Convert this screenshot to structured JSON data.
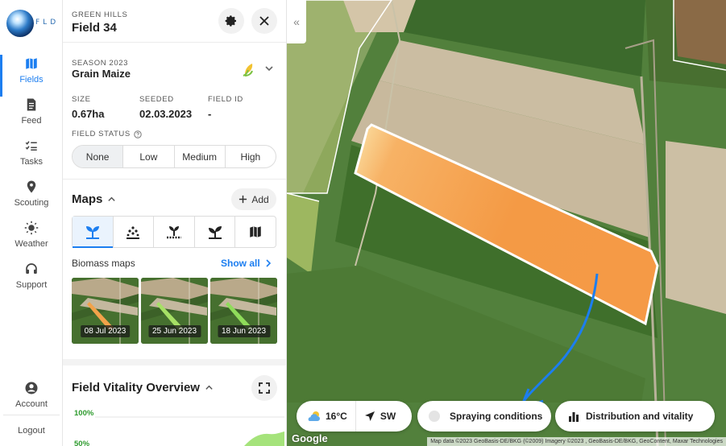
{
  "brand": {
    "wordmark": "FLD"
  },
  "nav": {
    "items": [
      {
        "label": "Fields",
        "icon": "map-icon",
        "active": true
      },
      {
        "label": "Feed",
        "icon": "document-icon"
      },
      {
        "label": "Tasks",
        "icon": "checklist-icon"
      },
      {
        "label": "Scouting",
        "icon": "pin-icon"
      },
      {
        "label": "Weather",
        "icon": "sun-icon"
      },
      {
        "label": "Support",
        "icon": "headset-icon"
      }
    ],
    "account_label": "Account",
    "logout_label": "Logout"
  },
  "field": {
    "farm": "GREEN HILLS",
    "name": "Field 34",
    "season_label": "SEASON 2023",
    "crop": "Grain Maize",
    "stats": [
      {
        "key": "SIZE",
        "value": "0.67ha"
      },
      {
        "key": "SEEDED",
        "value": "02.03.2023"
      },
      {
        "key": "FIELD ID",
        "value": "-"
      }
    ],
    "status_label": "FIELD STATUS",
    "status_options": [
      "None",
      "Low",
      "Medium",
      "High"
    ],
    "status_selected": "None"
  },
  "maps": {
    "title": "Maps",
    "add_label": "Add",
    "tabs": [
      "biomass-icon",
      "seeding-icon",
      "soil-icon",
      "yield-icon",
      "fieldmap-icon"
    ],
    "selected_tab": 0,
    "biomass_title": "Biomass maps",
    "show_all_label": "Show all",
    "thumbnails": [
      {
        "date": "08 Jul 2023",
        "color": "#f2a24a"
      },
      {
        "date": "25 Jun 2023",
        "color": "#a6e065"
      },
      {
        "date": "18 Jun 2023",
        "color": "#8fdc5a"
      }
    ]
  },
  "vitality": {
    "title": "Field Vitality Overview",
    "axis_top": "100%",
    "axis_second": "50%"
  },
  "map": {
    "weather_temp": "16°C",
    "wind_dir": "SW",
    "spraying_label": "Spraying conditions",
    "distribution_label": "Distribution and vitality",
    "google_label": "Google",
    "attribution": "Map data ©2023 GeoBasis-DE/BKG (©2009) Imagery ©2023 , GeoBasis-DE/BKG, GeoContent, Maxar Technologies",
    "accent": "#1c7ef0",
    "field_overlay_color": "#f39a3c"
  }
}
